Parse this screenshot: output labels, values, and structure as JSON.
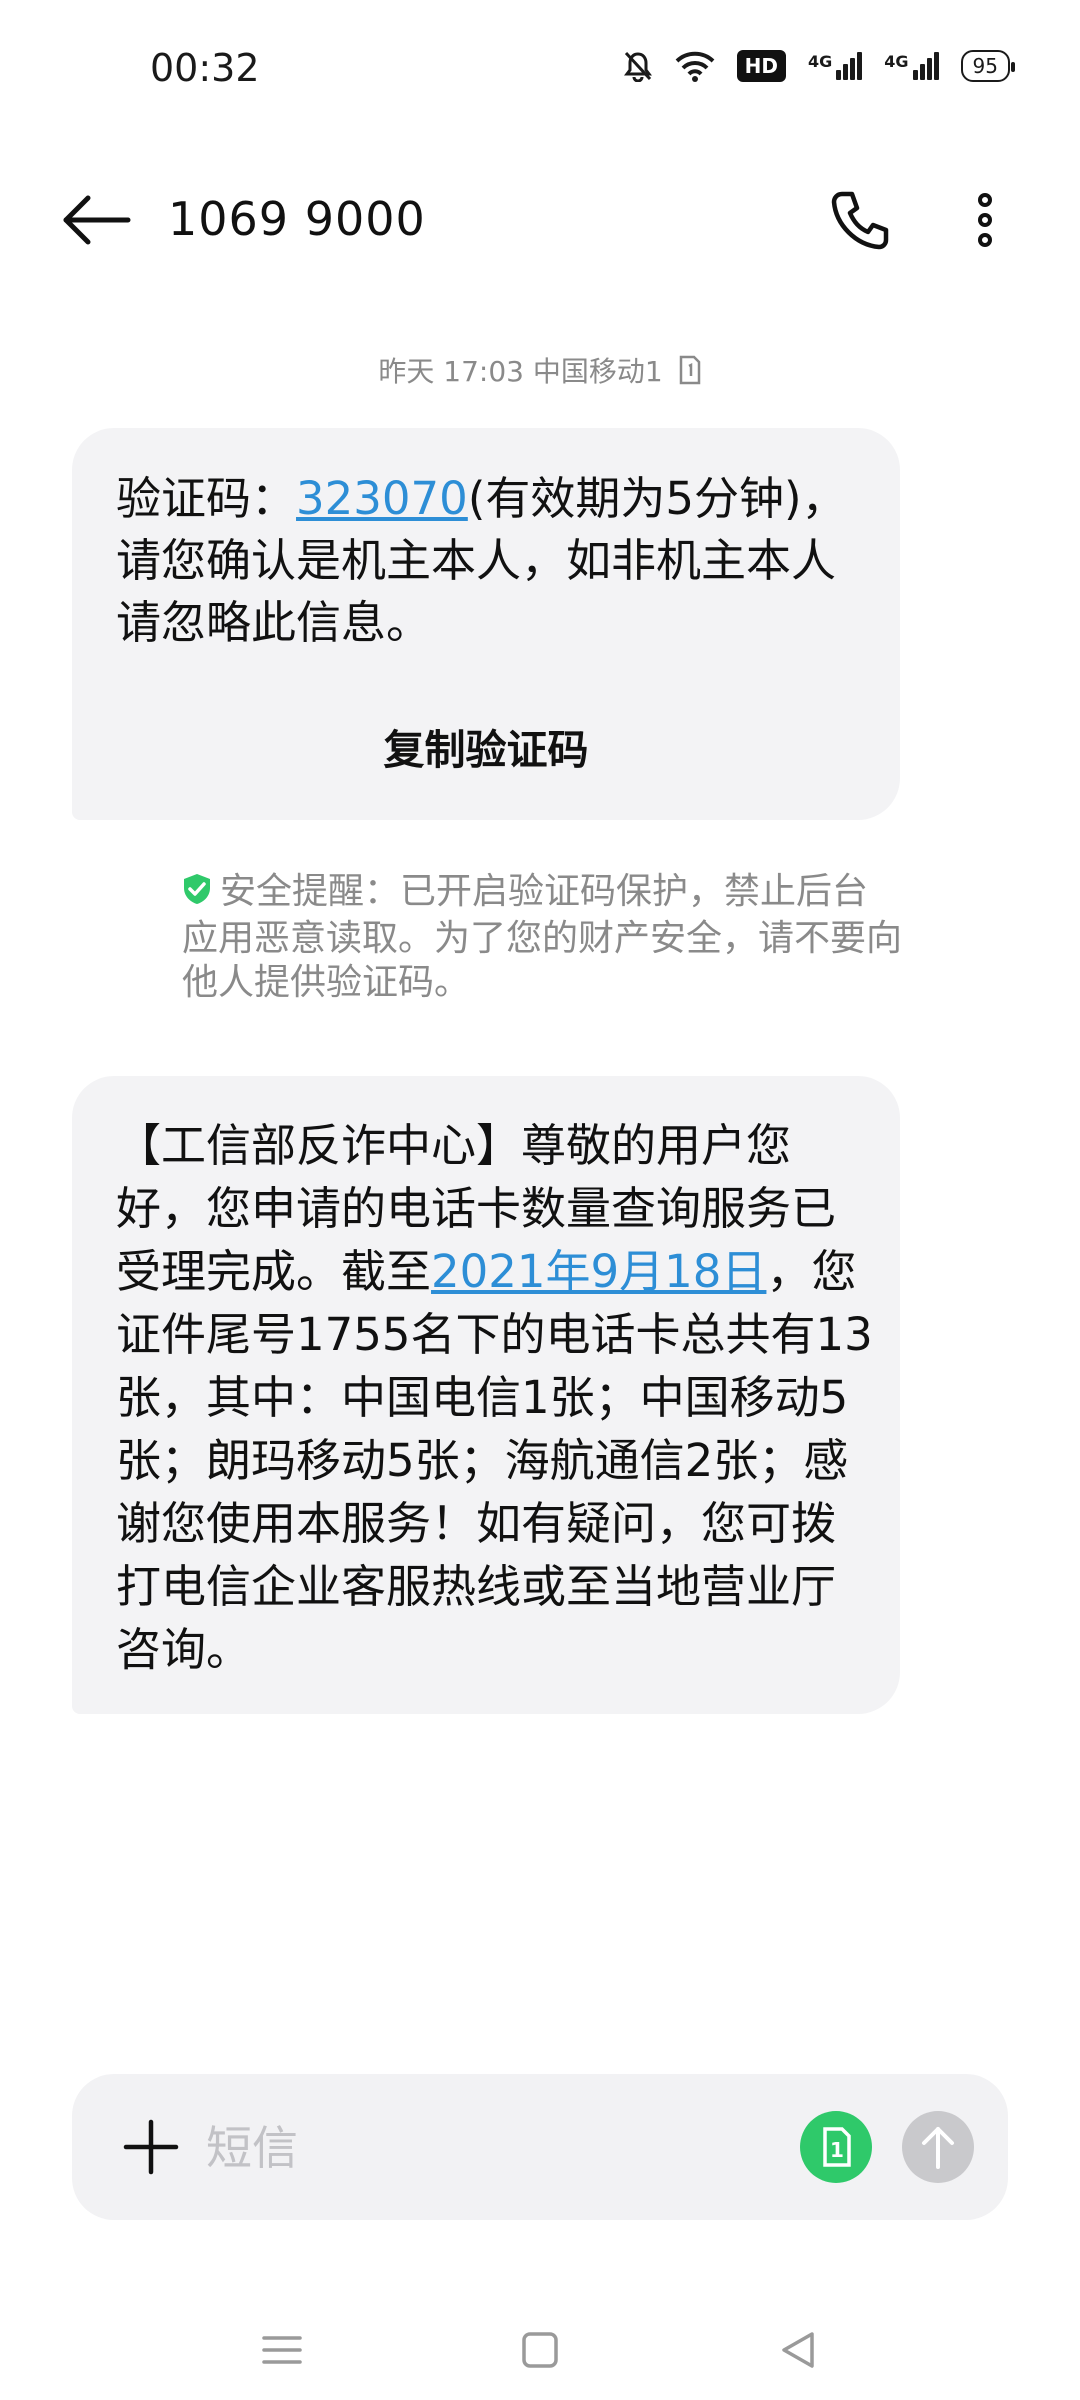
{
  "status_bar": {
    "time": "00:32",
    "hd_label": "HD",
    "signal1_label": "4G",
    "signal2_label": "4G",
    "battery": "95"
  },
  "header": {
    "title": "1069 9000"
  },
  "conversation": {
    "timestamp": "昨天 17:03  中国移动1",
    "messages": [
      {
        "text_before": "验证码：",
        "link_text": "323070",
        "text_after": "(有效期为5分钟)，请您确认是机主本人，如非机主本人请忽略此信息。",
        "action_label": "复制验证码"
      },
      {
        "text_before": "【工信部反诈中心】尊敬的用户您好，您申请的电话卡数量查询服务已受理完成。截至",
        "link_text": "2021年9月18日",
        "text_after": "，您证件尾号1755名下的电话卡总共有13张，其中：中国电信1张；中国移动5张；朗玛移动5张；海航通信2张；感谢您使用本服务！如有疑问，您可拨打电信企业客服热线或至当地营业厅咨询。"
      }
    ],
    "security_note": "安全提醒：已开启验证码保护，禁止后台应用恶意读取。为了您的财产安全，请不要向他人提供验证码。"
  },
  "composer": {
    "placeholder": "短信",
    "sim_label": "1"
  },
  "colors": {
    "link": "#2d8ed6",
    "bubble": "#f3f3f5",
    "sim_button": "#2fc96a",
    "shield": "#2fc96a"
  },
  "icons": [
    "back-arrow-icon",
    "phone-icon",
    "more-vert-icon",
    "sim-card-icon",
    "shield-check-icon",
    "plus-icon",
    "send-arrow-icon",
    "menu-icon",
    "home-square-icon",
    "back-triangle-icon"
  ]
}
